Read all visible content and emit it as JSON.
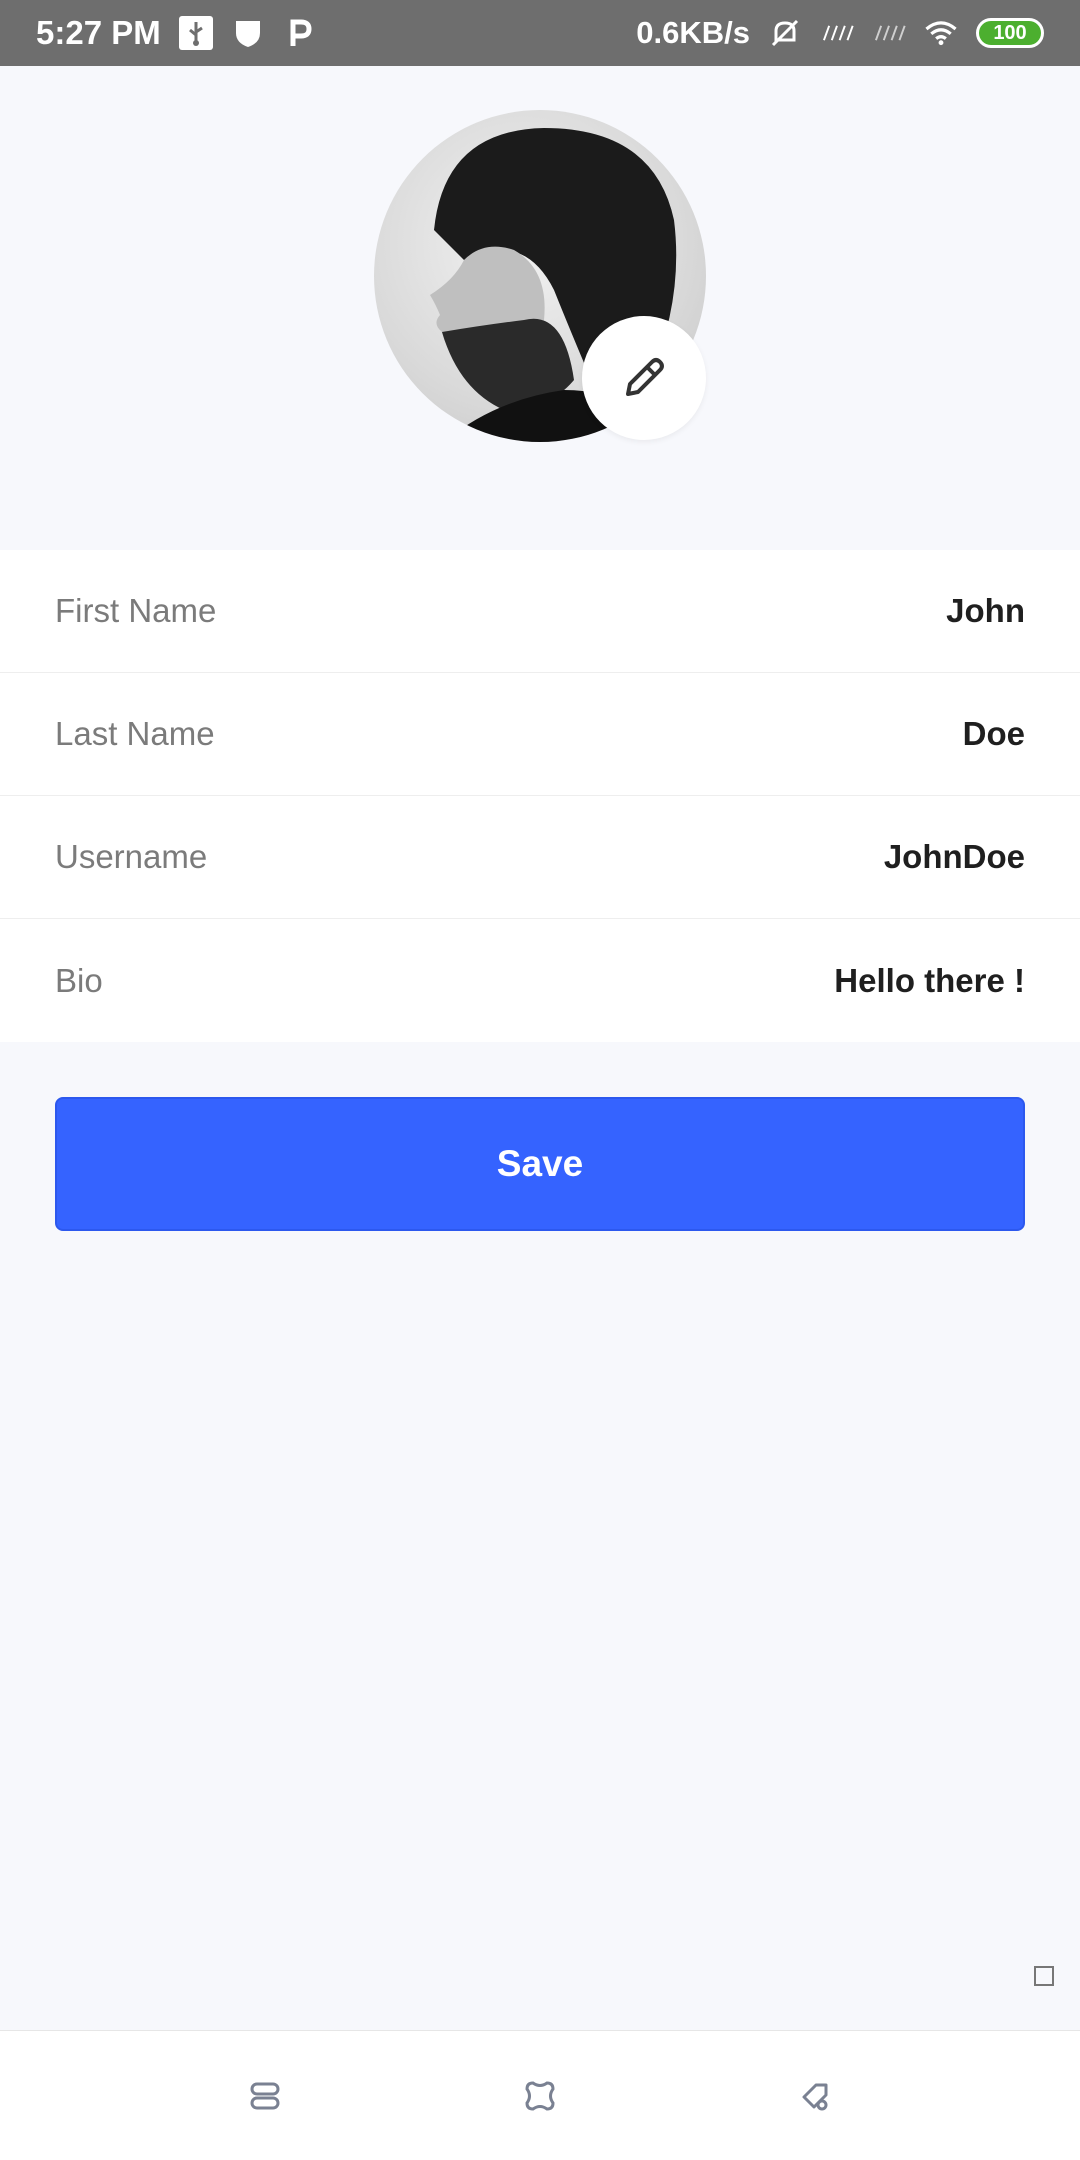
{
  "status_bar": {
    "time": "5:27 PM",
    "speed": "0.6KB/s",
    "battery": "100",
    "icons": [
      "usb-icon",
      "shield-icon",
      "p-icon",
      "mute-bell-icon",
      "signal-icon",
      "signal-icon",
      "wifi-icon",
      "battery-icon"
    ]
  },
  "profile": {
    "avatar_icon": "avatar-photo",
    "edit_icon": "pencil-icon"
  },
  "fields": [
    {
      "label": "First Name",
      "value": "John"
    },
    {
      "label": "Last Name",
      "value": "Doe"
    },
    {
      "label": "Username",
      "value": "JohnDoe"
    },
    {
      "label": "Bio",
      "value": "Hello there !"
    }
  ],
  "actions": {
    "save_label": "Save"
  },
  "nav": {
    "icons": [
      "recents-icon",
      "home-icon",
      "back-icon"
    ]
  },
  "colors": {
    "primary": "#3563ff",
    "background": "#f7f8fc",
    "status_bar": "#6e6e6e",
    "label": "#7b7b7b",
    "value": "#1f1f1f"
  }
}
